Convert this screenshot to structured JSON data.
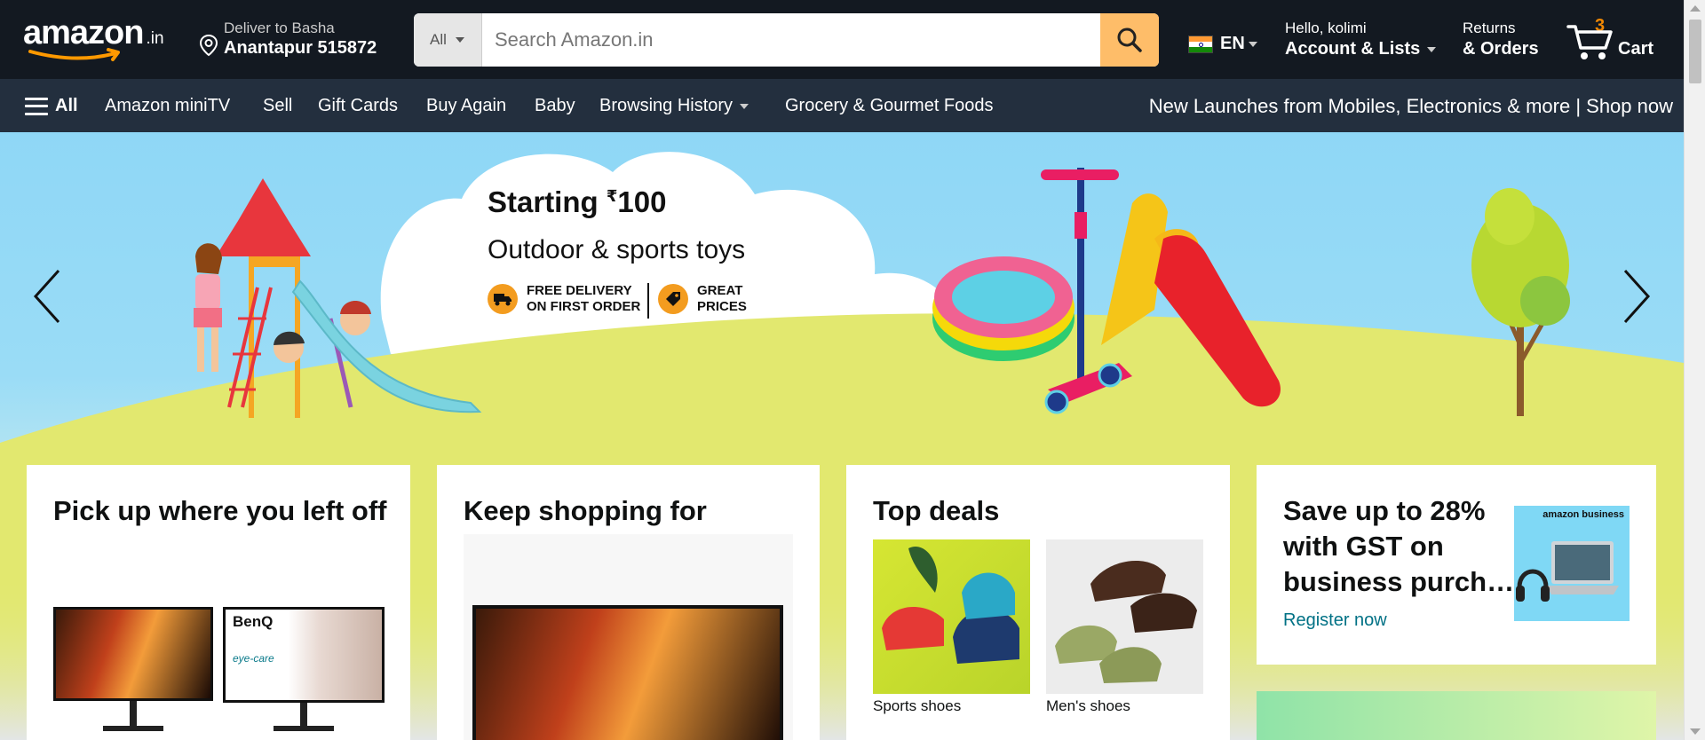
{
  "header": {
    "logo_text": "amazon",
    "logo_suffix": ".in",
    "deliver_line1": "Deliver to Basha",
    "deliver_line2": "Anantapur 515872",
    "search_category": "All",
    "search_placeholder": "Search Amazon.in",
    "language": "EN",
    "account_line1": "Hello, kolimi",
    "account_line2": "Account & Lists",
    "returns_line1": "Returns",
    "returns_line2": "& Orders",
    "cart_count": "3",
    "cart_label": "Cart"
  },
  "subnav": {
    "all_label": "All",
    "items": [
      "Amazon miniTV",
      "Sell",
      "Gift Cards",
      "Buy Again",
      "Baby",
      "Browsing History",
      "Grocery & Gourmet Foods"
    ],
    "promo": "New Launches from Mobiles, Electronics & more | Shop now"
  },
  "hero": {
    "title_prefix": "Starting ",
    "currency": "₹",
    "title_amount": "100",
    "subtitle": "Outdoor & sports toys",
    "badge1_line1": "FREE DELIVERY",
    "badge1_line2": "ON FIRST ORDER",
    "badge2_line1": "GREAT",
    "badge2_line2": "PRICES"
  },
  "cards": {
    "card1_title": "Pick up where you left off",
    "monitor_brand": "BenQ",
    "monitor_feature": "eye-care",
    "card2_title": "Keep shopping for",
    "card3_title": "Top deals",
    "card3_item1": "Sports shoes",
    "card3_item2": "Men's shoes",
    "card4_title": "Save up to 28% with GST on business purch…",
    "card4_link": "Register now",
    "card4_badge": "amazon business"
  },
  "colors": {
    "nav_bg": "#131921",
    "subnav_bg": "#232f3e",
    "search_button": "#febd69",
    "cart_count": "#f08804",
    "link": "#007185"
  }
}
